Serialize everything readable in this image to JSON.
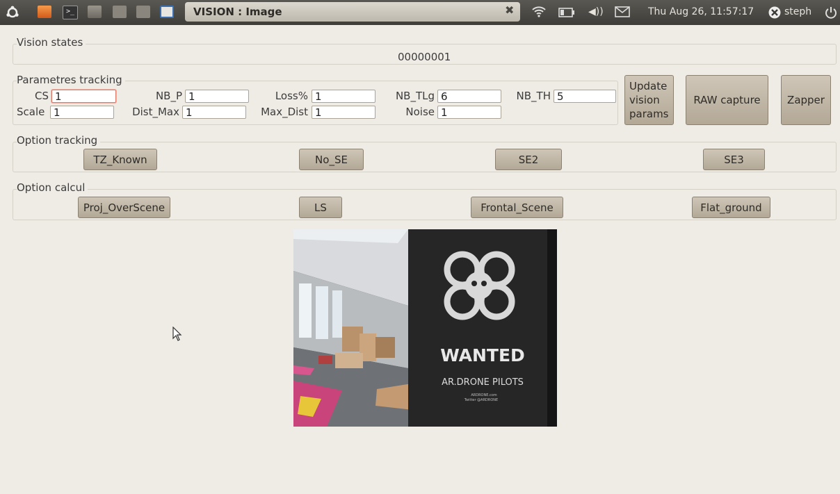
{
  "panel": {
    "window_title": "VISION : Image",
    "datetime": "Thu Aug 26, 11:57:17",
    "user": "steph",
    "icons": [
      "ubuntu-logo-icon",
      "folder-icon",
      "terminal-icon",
      "folder-2-icon",
      "window-icon",
      "window-2-icon",
      "window-3-icon",
      "close-icon",
      "wifi-icon",
      "battery-icon",
      "volume-icon",
      "mail-icon",
      "user-status-icon",
      "power-icon"
    ]
  },
  "vision_states": {
    "label": "Vision states",
    "value": "00000001"
  },
  "tracking": {
    "label": "Parametres tracking",
    "fields": {
      "cs": {
        "label": "CS",
        "value": "1"
      },
      "nb_p": {
        "label": "NB_P",
        "value": "1"
      },
      "loss": {
        "label": "Loss%",
        "value": "1"
      },
      "nb_tlg": {
        "label": "NB_TLg",
        "value": "6"
      },
      "nb_th": {
        "label": "NB_TH",
        "value": "5"
      },
      "scale": {
        "label": "Scale",
        "value": "1"
      },
      "dist_max": {
        "label": "Dist_Max",
        "value": "1"
      },
      "max_dist": {
        "label": "Max_Dist",
        "value": "1"
      },
      "noise": {
        "label": "Noise",
        "value": "1"
      }
    },
    "update_button": "Update vision params",
    "raw_button": "RAW capture",
    "zapper_button": "Zapper"
  },
  "option_tracking": {
    "label": "Option tracking",
    "buttons": [
      "TZ_Known",
      "No_SE",
      "SE2",
      "SE3"
    ]
  },
  "option_calcul": {
    "label": "Option calcul",
    "buttons": [
      "Proj_OverScene",
      "LS",
      "Frontal_Scene",
      "Flat_ground"
    ]
  },
  "camera": {
    "banner_title": "WANTED",
    "banner_subtitle": "AR.DRONE PILOTS",
    "banner_small_1": "ARDRONE.com",
    "banner_small_2": "Twitter @ARDRONE"
  },
  "colors": {
    "panel_bg": "#45443f",
    "window_bg": "#efebe5",
    "button_bg": "#c2b8a8",
    "focus_border": "#e07a6a"
  }
}
